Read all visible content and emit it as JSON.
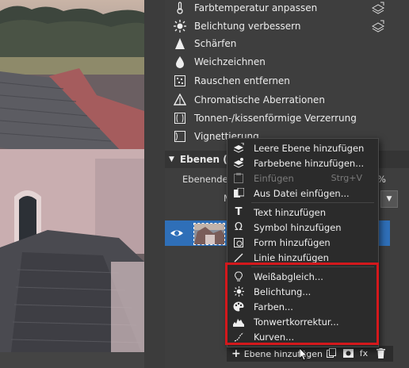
{
  "tools": [
    {
      "label": "Farbtemperatur anpassen",
      "icon": "thermometer-icon"
    },
    {
      "label": "Belichtung verbessern",
      "icon": "sun-icon"
    },
    {
      "label": "Schärfen",
      "icon": "triangle-icon"
    },
    {
      "label": "Weichzeichnen",
      "icon": "drop-icon"
    },
    {
      "label": "Rauschen entfernen",
      "icon": "noise-icon"
    },
    {
      "label": "Chromatische Aberrationen",
      "icon": "prism-icon"
    },
    {
      "label": "Tonnen-/kissenförmige Verzerrung",
      "icon": "distortion-icon"
    },
    {
      "label": "Vignettierung",
      "icon": "vignette-icon"
    }
  ],
  "layers_panel": {
    "header": "Ebenen (E",
    "opacity_label": "Ebenendec",
    "opacity_suffix": "%",
    "mode_label": "M"
  },
  "context_menu": {
    "items": [
      {
        "label": "Leere Ebene hinzufügen",
        "icon": "layer-add-icon",
        "shortcut": "",
        "disabled": false
      },
      {
        "label": "Farbebene hinzufügen...",
        "icon": "color-layer-icon",
        "shortcut": "",
        "disabled": false
      },
      {
        "label": "Einfügen",
        "icon": "paste-icon",
        "shortcut": "Strg+V",
        "disabled": true
      },
      {
        "label": "Aus Datei einfügen...",
        "icon": "file-insert-icon",
        "shortcut": "",
        "disabled": false
      },
      {
        "label": "Text hinzufügen",
        "icon": "text-icon",
        "shortcut": "",
        "disabled": false
      },
      {
        "label": "Symbol hinzufügen",
        "icon": "omega-icon",
        "shortcut": "",
        "disabled": false
      },
      {
        "label": "Form hinzufügen",
        "icon": "shape-icon",
        "shortcut": "",
        "disabled": false
      },
      {
        "label": "Linie hinzufügen",
        "icon": "line-icon",
        "shortcut": "",
        "disabled": false
      },
      {
        "label": "Weißabgleich...",
        "icon": "bulb-icon",
        "shortcut": "",
        "disabled": false
      },
      {
        "label": "Belichtung...",
        "icon": "sun-icon",
        "shortcut": "",
        "disabled": false
      },
      {
        "label": "Farben...",
        "icon": "palette-icon",
        "shortcut": "",
        "disabled": false
      },
      {
        "label": "Tonwertkorrektur...",
        "icon": "histogram-icon",
        "shortcut": "",
        "disabled": false
      },
      {
        "label": "Kurven...",
        "icon": "curve-icon",
        "shortcut": "",
        "disabled": false
      }
    ]
  },
  "toolbar": {
    "add_layer_label": "Ebene hinzufügen",
    "fx_label": "fx"
  },
  "colors": {
    "accent_blue": "#2f6fb8",
    "highlight_red": "#d4181c"
  }
}
